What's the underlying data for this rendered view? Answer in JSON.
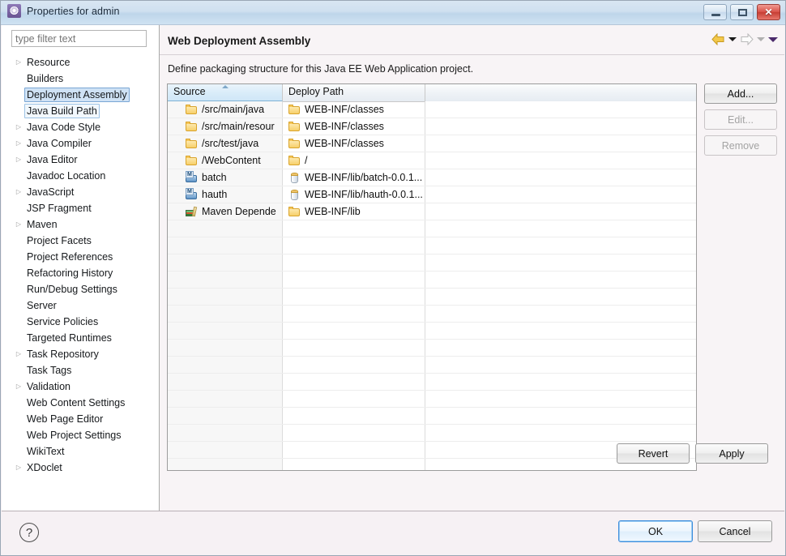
{
  "window": {
    "title": "Properties for admin",
    "icon": "gear-icon",
    "buttons": {
      "minimize": "minimize-icon",
      "maximize": "maximize-icon",
      "close": "✕"
    }
  },
  "sidebar": {
    "filter_placeholder": "type filter text",
    "items": [
      {
        "label": "Resource",
        "expandable": true,
        "state": "normal"
      },
      {
        "label": "Builders",
        "expandable": false,
        "state": "normal"
      },
      {
        "label": "Deployment Assembly",
        "expandable": false,
        "state": "selected"
      },
      {
        "label": "Java Build Path",
        "expandable": false,
        "state": "focused"
      },
      {
        "label": "Java Code Style",
        "expandable": true,
        "state": "normal"
      },
      {
        "label": "Java Compiler",
        "expandable": true,
        "state": "normal"
      },
      {
        "label": "Java Editor",
        "expandable": true,
        "state": "normal"
      },
      {
        "label": "Javadoc Location",
        "expandable": false,
        "state": "normal"
      },
      {
        "label": "JavaScript",
        "expandable": true,
        "state": "normal"
      },
      {
        "label": "JSP Fragment",
        "expandable": false,
        "state": "normal"
      },
      {
        "label": "Maven",
        "expandable": true,
        "state": "normal"
      },
      {
        "label": "Project Facets",
        "expandable": false,
        "state": "normal"
      },
      {
        "label": "Project References",
        "expandable": false,
        "state": "normal"
      },
      {
        "label": "Refactoring History",
        "expandable": false,
        "state": "normal"
      },
      {
        "label": "Run/Debug Settings",
        "expandable": false,
        "state": "normal"
      },
      {
        "label": "Server",
        "expandable": false,
        "state": "normal"
      },
      {
        "label": "Service Policies",
        "expandable": false,
        "state": "normal"
      },
      {
        "label": "Targeted Runtimes",
        "expandable": false,
        "state": "normal"
      },
      {
        "label": "Task Repository",
        "expandable": true,
        "state": "normal"
      },
      {
        "label": "Task Tags",
        "expandable": false,
        "state": "normal"
      },
      {
        "label": "Validation",
        "expandable": true,
        "state": "normal"
      },
      {
        "label": "Web Content Settings",
        "expandable": false,
        "state": "normal"
      },
      {
        "label": "Web Page Editor",
        "expandable": false,
        "state": "normal"
      },
      {
        "label": "Web Project Settings",
        "expandable": false,
        "state": "normal"
      },
      {
        "label": "WikiText",
        "expandable": false,
        "state": "normal"
      },
      {
        "label": "XDoclet",
        "expandable": true,
        "state": "normal"
      }
    ]
  },
  "page": {
    "title": "Web Deployment Assembly",
    "description": "Define packaging structure for this Java EE Web Application project.",
    "nav": {
      "back_icon": "back-arrow-icon",
      "back_menu_icon": "chevron-down-icon",
      "forward_icon": "forward-arrow-icon",
      "forward_menu_icon": "chevron-down-icon",
      "view_menu_icon": "chevron-down-icon"
    }
  },
  "table": {
    "columns": [
      "Source",
      "Deploy Path",
      ""
    ],
    "sorted_column": "Source",
    "sort_direction": "ascending",
    "empty_row_count": 16,
    "rows": [
      {
        "source": "/src/main/java",
        "source_icon": "folder-icon",
        "deploy": "WEB-INF/classes",
        "deploy_icon": "folder-icon"
      },
      {
        "source": "/src/main/resour",
        "source_icon": "folder-icon",
        "deploy": "WEB-INF/classes",
        "deploy_icon": "folder-icon"
      },
      {
        "source": "/src/test/java",
        "source_icon": "folder-icon",
        "deploy": "WEB-INF/classes",
        "deploy_icon": "folder-icon"
      },
      {
        "source": "/WebContent",
        "source_icon": "folder-icon",
        "deploy": "/",
        "deploy_icon": "folder-icon"
      },
      {
        "source": "batch",
        "source_icon": "maven-project-icon",
        "deploy": "WEB-INF/lib/batch-0.0.1...",
        "deploy_icon": "jar-icon"
      },
      {
        "source": "hauth",
        "source_icon": "maven-project-icon",
        "deploy": "WEB-INF/lib/hauth-0.0.1...",
        "deploy_icon": "jar-icon"
      },
      {
        "source": "Maven Depende",
        "source_icon": "maven-dependencies-icon",
        "deploy": "WEB-INF/lib",
        "deploy_icon": "folder-icon"
      }
    ]
  },
  "side_buttons": [
    {
      "label": "Add...",
      "enabled": true
    },
    {
      "label": "Edit...",
      "enabled": false
    },
    {
      "label": "Remove",
      "enabled": false
    }
  ],
  "page_buttons": [
    {
      "label": "Revert",
      "enabled": true
    },
    {
      "label": "Apply",
      "enabled": true
    }
  ],
  "footer": {
    "help_icon": "?",
    "ok_label": "OK",
    "cancel_label": "Cancel"
  },
  "colors": {
    "titlebar": "#cfe0f0",
    "dialog_bg": "#f6f1f4",
    "selection": "#cfe2f5",
    "sorted_header": "#d9ecf9",
    "folder": "#f7cf6a",
    "default_button_border": "#3c8ddc"
  }
}
